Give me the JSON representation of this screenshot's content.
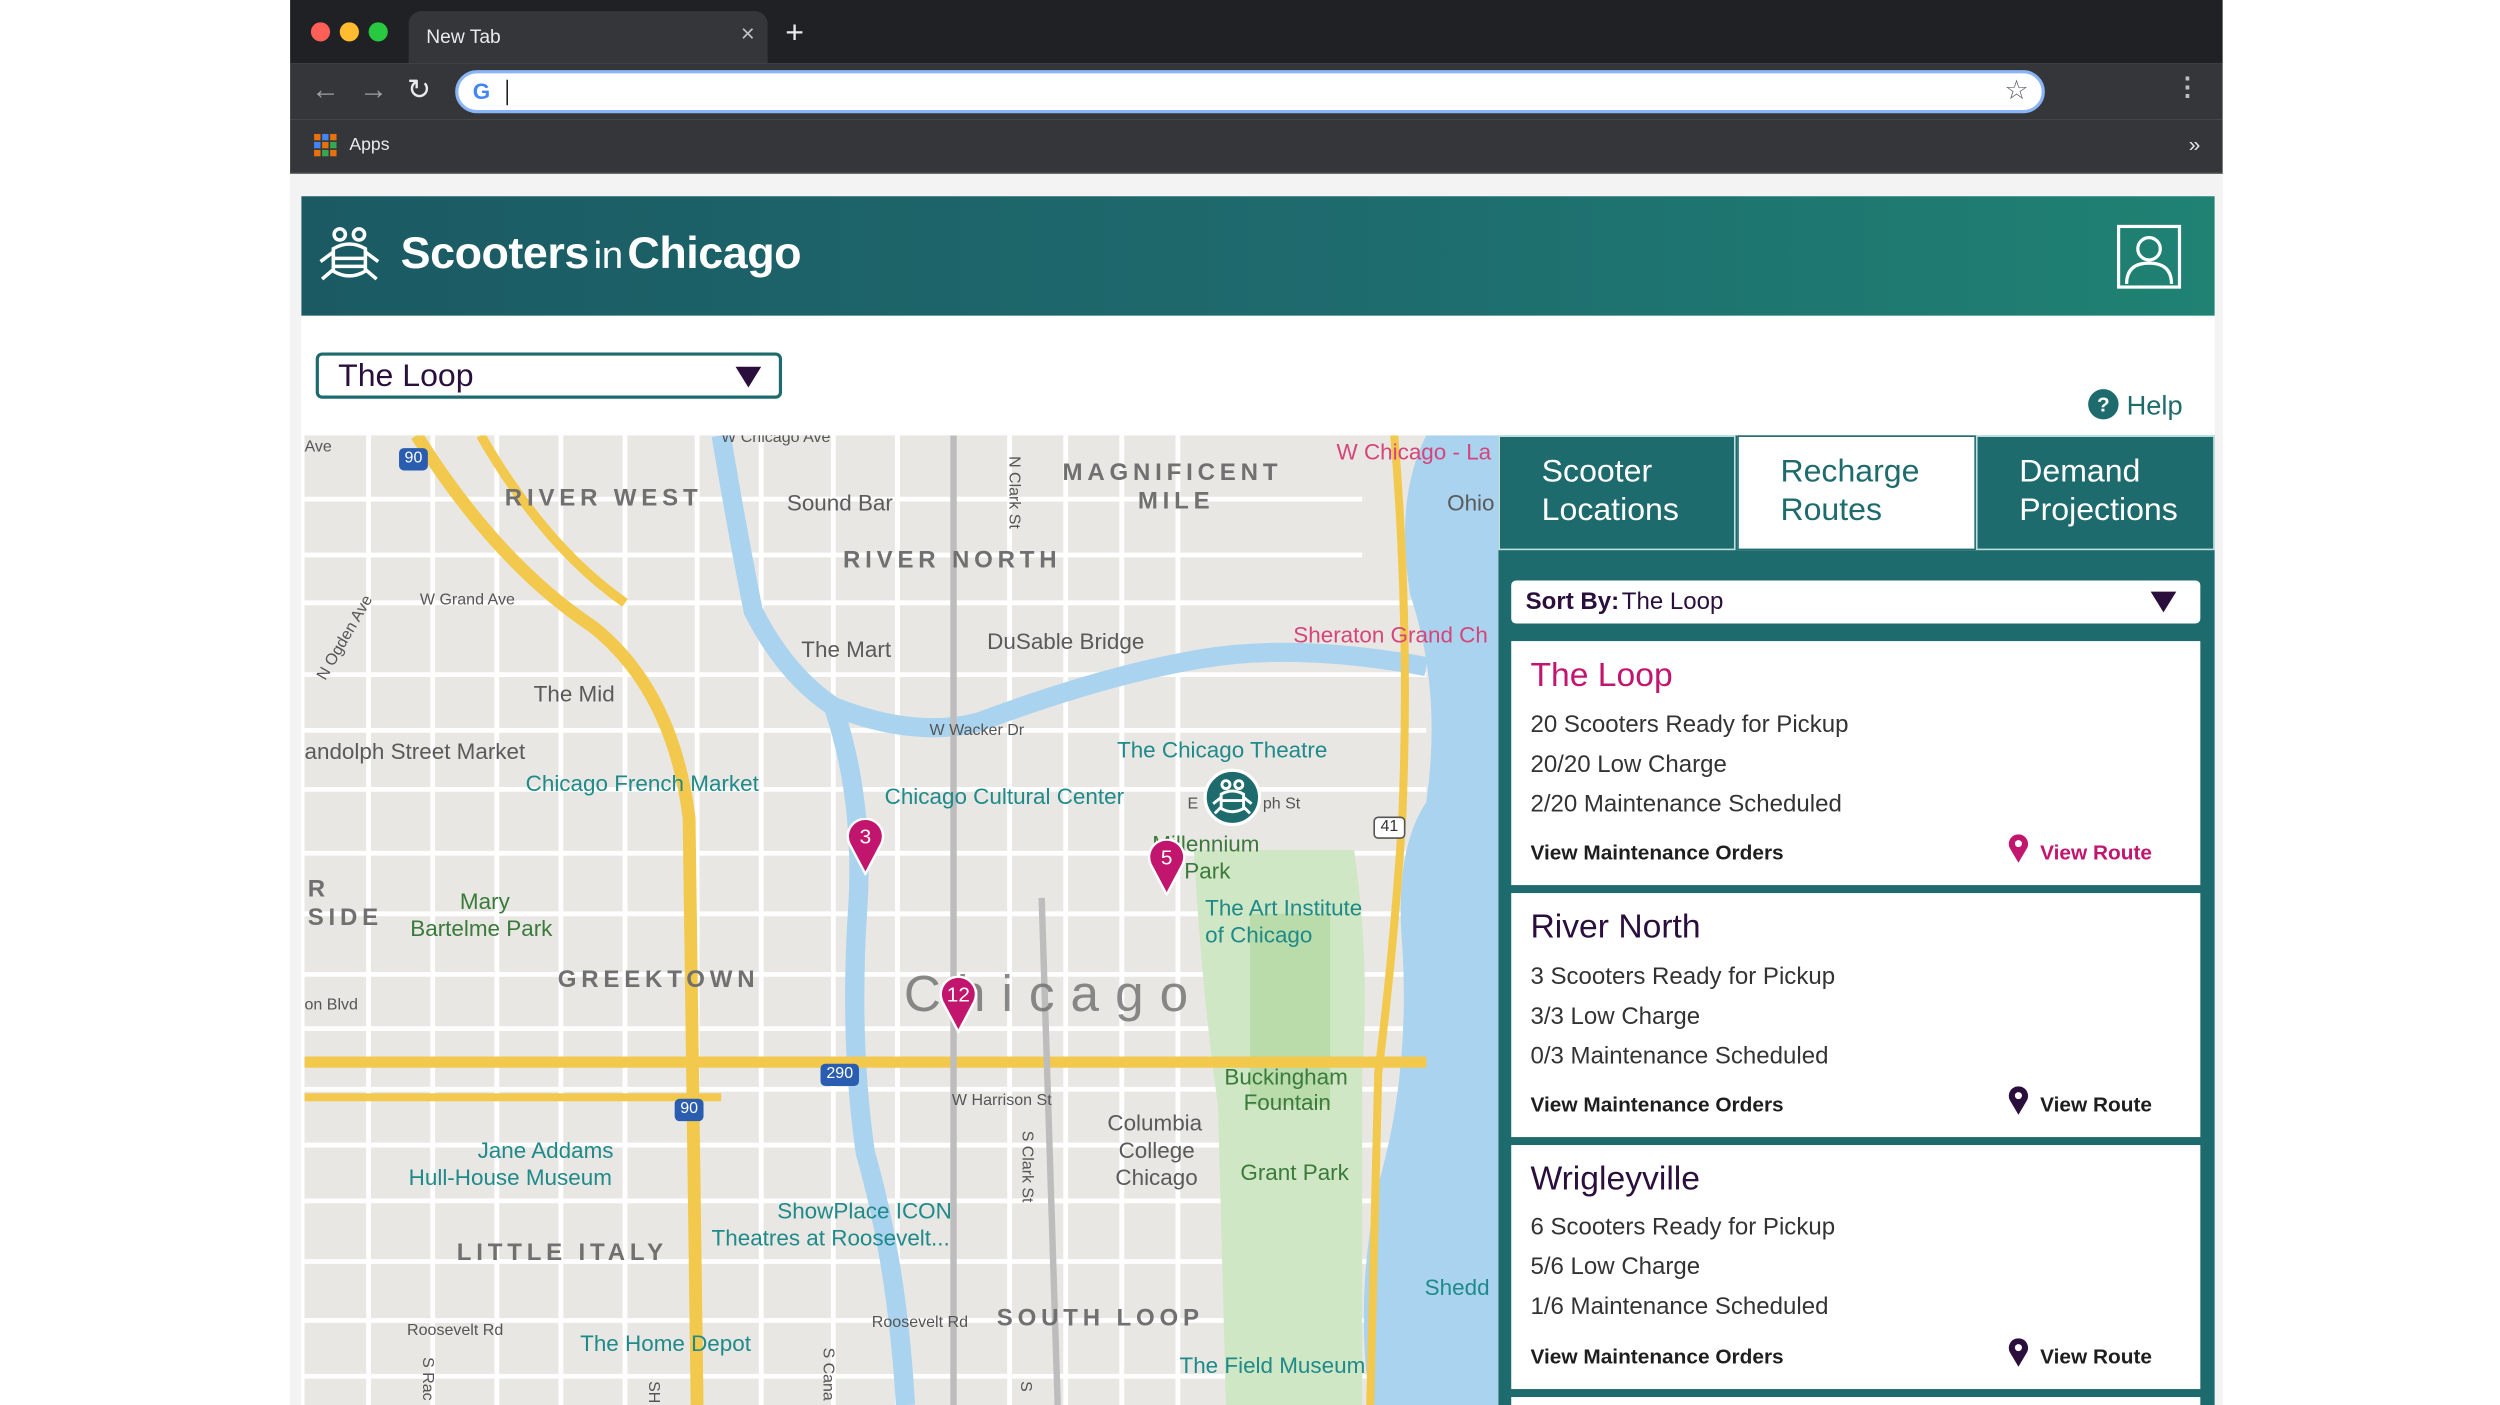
{
  "browser": {
    "tab_title": "New Tab",
    "tab_close": "×",
    "new_tab": "+",
    "url": "",
    "bookmarks_label": "Apps",
    "more_bookmarks": "»"
  },
  "app": {
    "brand_left": "Scooters",
    "brand_mid": "in",
    "brand_right": "Chicago",
    "location_select": "The Loop",
    "help_label": "Help"
  },
  "map": {
    "city": "Chicago",
    "districts": {
      "river_west": "RIVER WEST",
      "magnificent": "MAGNIFICENT",
      "mile": "MILE",
      "river_north": "RIVER NORTH",
      "greektown": "GREEKTOWN",
      "little_italy": "LITTLE ITALY",
      "south_loop": "SOUTH LOOP",
      "side_r": "R",
      "side": "SIDE"
    },
    "pois": {
      "sound_bar": "Sound Bar",
      "the_mart": "The Mart",
      "dusable": "DuSable Bridge",
      "the_mid": "The Mid",
      "randolph": "andolph Street Market",
      "french_market": "Chicago French Market",
      "chicago_theatre": "The Chicago Theatre",
      "cultural_center": "Chicago Cultural Center",
      "millennium_1": "Millennium",
      "millennium_2": "Park",
      "art_inst_1": "The Art Institute",
      "art_inst_2": "of Chicago",
      "mary_1": "Mary",
      "mary_2": "Bartelme Park",
      "buckingham_1": "Buckingham",
      "buckingham_2": "Fountain",
      "columbia_1": "Columbia",
      "columbia_2": "College",
      "columbia_3": "Chicago",
      "grant_park": "Grant Park",
      "jane_1": "Jane Addams",
      "jane_2": "Hull-House Museum",
      "showplace_1": "ShowPlace ICON",
      "showplace_2": "Theatres at Roosevelt...",
      "shedd": "Shedd",
      "home_depot": "The Home Depot",
      "field_museum": "The Field Museum",
      "sheraton": "Sheraton Grand Ch",
      "w_chicago": "W Chicago - La",
      "ohio": "Ohio"
    },
    "streets": {
      "w_grand": "W Grand Ave",
      "n_ogden": "N Ogden Ave",
      "w_wacker": "W Wacker Dr",
      "n_clark": "N Clark St",
      "w_harrison": "W Harrison St",
      "s_clark": "S Clark St",
      "roosevelt_rd": "Roosevelt Rd",
      "roosevelt_rd2": "Roosevelt Rd",
      "w_chicago_ave": "W Chicago Ave",
      "ave": "Ave",
      "on_blvd": "on Blvd",
      "ph_st": "ph St",
      "e": "E",
      "s_rac": "S Rac",
      "s_cana": "S Cana",
      "sh": "SH",
      "s": "S"
    },
    "shields": {
      "i90_a": "90",
      "i90_b": "90",
      "i290": "290",
      "us41": "41"
    },
    "markers": [
      {
        "label": "3"
      },
      {
        "label": "5"
      },
      {
        "label": "12"
      }
    ]
  },
  "panel": {
    "tabs": [
      {
        "label": "Scooter Locations"
      },
      {
        "label": "Recharge Routes"
      },
      {
        "label": "Demand Projections"
      }
    ],
    "sort_key": "Sort By:",
    "sort_value": "The Loop",
    "cards": [
      {
        "title": "The Loop",
        "ready": "20 Scooters Ready for Pickup",
        "low": "20/20 Low Charge",
        "maint": "2/20 Maintenance Scheduled",
        "orders": "View Maintenance Orders",
        "route": "View Route"
      },
      {
        "title": "River North",
        "ready": "3 Scooters Ready for Pickup",
        "low": "3/3 Low Charge",
        "maint": "0/3 Maintenance Scheduled",
        "orders": "View Maintenance Orders",
        "route": "View Route"
      },
      {
        "title": "Wrigleyville",
        "ready": "6 Scooters Ready for Pickup",
        "low": "5/6 Low Charge",
        "maint": "1/6 Maintenance Scheduled",
        "orders": "View Maintenance Orders",
        "route": "View Route"
      }
    ]
  },
  "colors": {
    "brand": "#1e6b6e",
    "accent": "#c2166e",
    "text_dark": "#2a0f3d"
  },
  "icons": {
    "logo": "scooters-logo-icon",
    "user": "user-icon",
    "help": "help-icon",
    "pin": "map-pin-icon"
  }
}
